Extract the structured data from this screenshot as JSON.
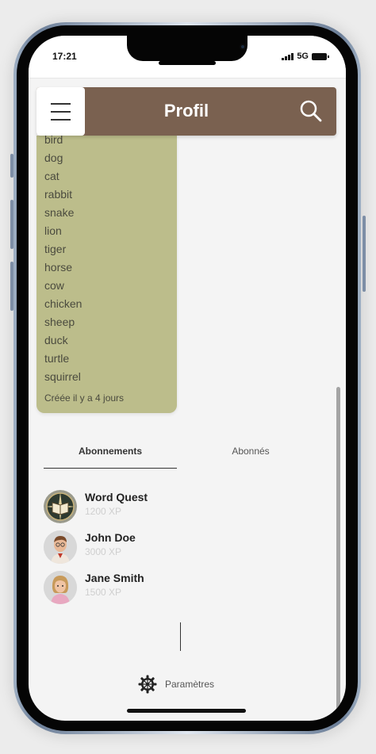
{
  "status_bar": {
    "time": "17:21",
    "network": "5G"
  },
  "header": {
    "title": "Profil"
  },
  "word_card": {
    "words": [
      "bird",
      "dog",
      "cat",
      "rabbit",
      "snake",
      "lion",
      "tiger",
      "horse",
      "cow",
      "chicken",
      "sheep",
      "duck",
      "turtle",
      "squirrel"
    ],
    "created": "Créée il y a 4 jours"
  },
  "tabs": {
    "subscriptions": "Abonnements",
    "subscribers": "Abonnés"
  },
  "follows": [
    {
      "name": "Word Quest",
      "xp": "1200 XP"
    },
    {
      "name": "John Doe",
      "xp": "3000 XP"
    },
    {
      "name": "Jane Smith",
      "xp": "1500 XP"
    }
  ],
  "footer": {
    "settings_label": "Paramètres"
  },
  "colors": {
    "header": "#7a6150",
    "card": "#bcbd8b",
    "background": "#f4f4f4"
  }
}
